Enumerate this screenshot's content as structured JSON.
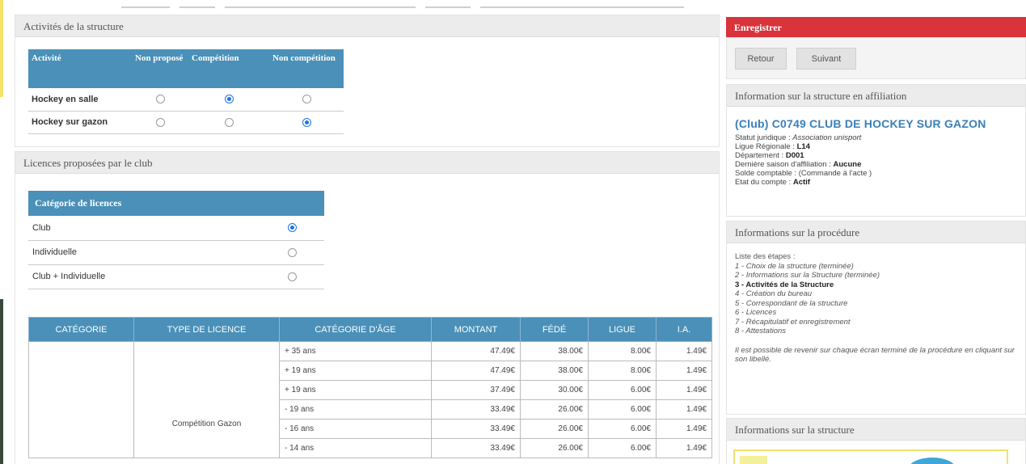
{
  "activities": {
    "title": "Activités de la structure",
    "headers": [
      "Activité",
      "Non proposé",
      "Compétition",
      "Non compétition"
    ],
    "rows": [
      {
        "name": "Hockey en salle",
        "selected": "Compétition"
      },
      {
        "name": "Hockey sur gazon",
        "selected": "Non compétition"
      }
    ]
  },
  "licences": {
    "title": "Licences proposées par le club",
    "category_header": "Catégorie de licences",
    "options": [
      {
        "label": "Club",
        "selected": true
      },
      {
        "label": "Individuelle",
        "selected": false
      },
      {
        "label": "Club + Individuelle",
        "selected": false
      }
    ]
  },
  "price_table": {
    "headers": [
      "CATÉGORIE",
      "TYPE DE LICENCE",
      "CATÉGORIE D'ÂGE",
      "MONTANT",
      "FÉDÉ",
      "LIGUE",
      "I.A."
    ],
    "licence_type": "Compétition Gazon",
    "rows": [
      {
        "age": "+ 35 ans",
        "montant": "47.49€",
        "fede": "38.00€",
        "ligue": "8.00€",
        "ia": "1.49€"
      },
      {
        "age": "+ 19 ans",
        "montant": "47.49€",
        "fede": "38.00€",
        "ligue": "8.00€",
        "ia": "1.49€"
      },
      {
        "age": "+ 19 ans",
        "montant": "37.49€",
        "fede": "30.00€",
        "ligue": "6.00€",
        "ia": "1.49€"
      },
      {
        "age": "- 19 ans",
        "montant": "33.49€",
        "fede": "26.00€",
        "ligue": "6.00€",
        "ia": "1.49€"
      },
      {
        "age": "- 16 ans",
        "montant": "33.49€",
        "fede": "26.00€",
        "ligue": "6.00€",
        "ia": "1.49€"
      },
      {
        "age": "- 14 ans",
        "montant": "33.49€",
        "fede": "26.00€",
        "ligue": "6.00€",
        "ia": "1.49€"
      }
    ]
  },
  "actions": {
    "save": "Enregistrer",
    "back": "Retour",
    "next": "Suivant"
  },
  "affiliation": {
    "title": "Information sur la structure en affiliation",
    "club_name": "(Club) C0749 CLUB DE HOCKEY SUR GAZON",
    "lines": [
      {
        "label": "Statut juridique : ",
        "value": "Association unisport",
        "style": "italic"
      },
      {
        "label": "Ligue Régionale : ",
        "value": "L14",
        "style": "bold"
      },
      {
        "label": "Département : ",
        "value": "D001",
        "style": "bold"
      },
      {
        "label": "Dernière saison d'affiliation : ",
        "value": "Aucune",
        "style": "bold"
      },
      {
        "label": "Solde comptable : ",
        "value": "(Commande à l'acte )",
        "style": "normal"
      },
      {
        "label": "Etat du compte : ",
        "value": "Actif",
        "style": "bold"
      }
    ]
  },
  "procedure": {
    "title": "Informations sur la procédure",
    "intro": "Liste des étapes :",
    "steps": [
      {
        "text": "1 - Choix de la structure (terminée)",
        "style": "it"
      },
      {
        "text": "2 - Informations sur la Structure (terminée)",
        "style": "it"
      },
      {
        "text": "3 - Activités de la Structure",
        "style": "b"
      },
      {
        "text": "4 - Création du bureau",
        "style": "it"
      },
      {
        "text": "5 - Correspondant de la structure",
        "style": "it"
      },
      {
        "text": "6 - Licences",
        "style": "it"
      },
      {
        "text": "7 - Récapitulatif et enregistrement",
        "style": "it"
      },
      {
        "text": "8 - Attestations",
        "style": "it"
      }
    ],
    "note": "Il est possible de revenir sur chaque écran terminé de la procédure en cliquant sur son libellé."
  },
  "structure_info": {
    "title": "Informations sur la structure"
  },
  "colors": {
    "header_blue": "#4a90b8",
    "save_red": "#d9333b",
    "club_blue": "#3a7fb8"
  }
}
